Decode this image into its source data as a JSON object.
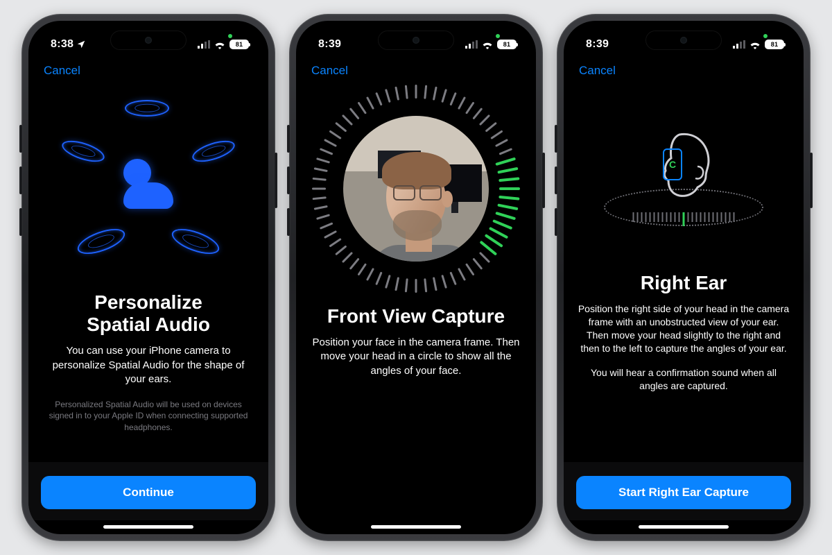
{
  "status": {
    "battery": "81"
  },
  "screens": [
    {
      "time": "8:38",
      "cancel": "Cancel",
      "title_line1": "Personalize",
      "title_line2": "Spatial Audio",
      "lead": "You can use your iPhone camera to personalize Spatial Audio for the shape of your ears.",
      "fine": "Personalized Spatial Audio will be used on devices signed in to your Apple ID when connecting supported headphones.",
      "button": "Continue"
    },
    {
      "time": "8:39",
      "cancel": "Cancel",
      "title": "Front View Capture",
      "lead": "Position your face in the camera frame. Then move your head in a circle to show all the angles of your face."
    },
    {
      "time": "8:39",
      "cancel": "Cancel",
      "title": "Right Ear",
      "lead": "Position the right side of your head in the camera frame with an unobstructed view of your ear. Then move your head slightly to the right and then to the left to capture the angles of your ear.",
      "confirmation": "You will hear a confirmation sound when all angles are captured.",
      "button": "Start Right Ear Capture"
    }
  ]
}
